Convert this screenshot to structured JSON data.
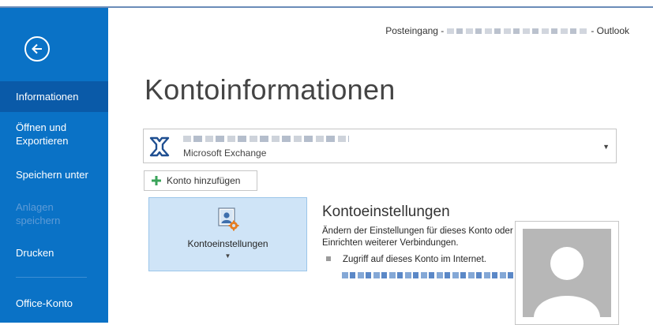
{
  "window": {
    "title_prefix": "Posteingang -",
    "title_suffix": "- Outlook"
  },
  "sidebar": {
    "items": [
      {
        "label": "Informationen",
        "state": "active"
      },
      {
        "label": "Öffnen und Exportieren",
        "line1": "Öffnen und",
        "line2": "Exportieren",
        "state": "normal"
      },
      {
        "label": "Speichern unter",
        "state": "normal"
      },
      {
        "label": "Anlagen speichern",
        "line1": "Anlagen",
        "line2": "speichern",
        "state": "disabled"
      },
      {
        "label": "Drucken",
        "state": "normal"
      },
      {
        "label": "Office-Konto",
        "state": "normal"
      }
    ],
    "back_icon": "back-arrow-circle-icon"
  },
  "main": {
    "title": "Kontoinformationen",
    "account": {
      "type": "Microsoft Exchange",
      "icon": "exchange-icon"
    },
    "add_account_label": "Konto hinzufügen",
    "settings_tile_label": "Kontoeinstellungen",
    "settings_section": {
      "heading": "Kontoeinstellungen",
      "description": "Ändern der Einstellungen für dieses Konto oder Einrichten weiterer Verbindungen.",
      "bullet": "Zugriff auf dieses Konto im Internet."
    }
  },
  "colors": {
    "sidebar_bg": "#0a72c6",
    "sidebar_active": "#0a5aa8",
    "tile_bg": "#cfe4f7",
    "plus_green": "#3aa35a",
    "exchange_blue": "#1f4f91"
  }
}
